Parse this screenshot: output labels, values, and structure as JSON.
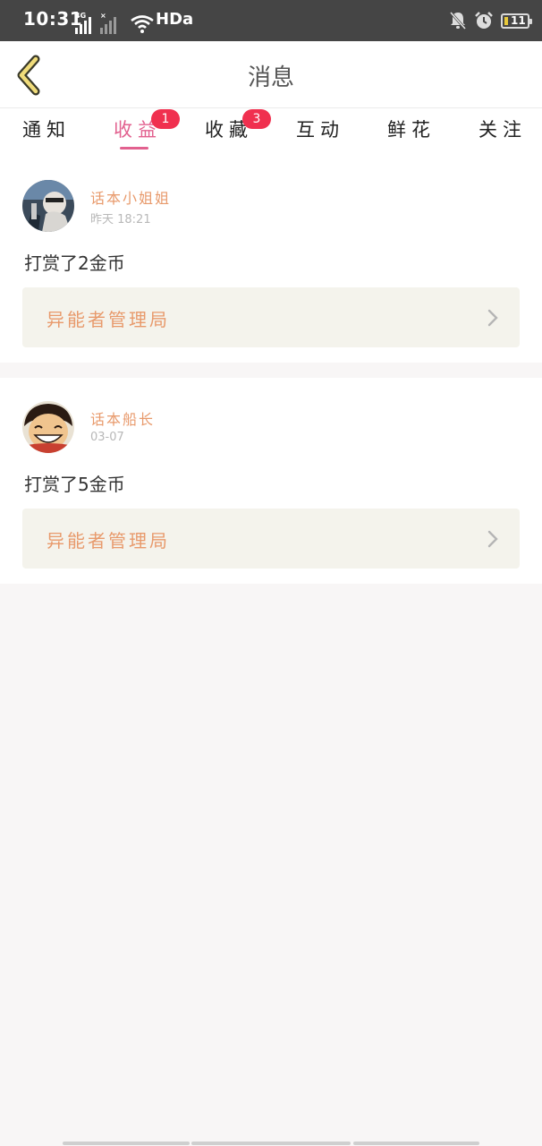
{
  "status_bar": {
    "time": "10:31",
    "network": "4G",
    "network_type": "HDa",
    "battery": "11",
    "icons": [
      "signal-icon",
      "signal-no-sim-icon",
      "wifi-icon",
      "mute-icon",
      "alarm-icon",
      "battery-icon"
    ]
  },
  "header": {
    "title": "消息",
    "back_icon": "chevron-left-icon"
  },
  "tabs": [
    {
      "label": "通知",
      "active": false
    },
    {
      "label": "收益",
      "active": true,
      "badge": "1"
    },
    {
      "label": "收藏",
      "active": false,
      "badge": "3"
    },
    {
      "label": "互动",
      "active": false
    },
    {
      "label": "鲜花",
      "active": false
    },
    {
      "label": "关注",
      "active": false
    }
  ],
  "messages": [
    {
      "sender": "话本小姐姐",
      "time": "昨天 18:21",
      "text": "打赏了2金币",
      "link": "异能者管理局"
    },
    {
      "sender": "话本船长",
      "time": "03-07",
      "text": "打赏了5金币",
      "link": "异能者管理局"
    }
  ],
  "colors": {
    "accent": "#e2618f",
    "badge": "#f0304f",
    "name": "#e89a6c",
    "link_bg": "#f4f3ec",
    "status_bar": "#454545"
  }
}
